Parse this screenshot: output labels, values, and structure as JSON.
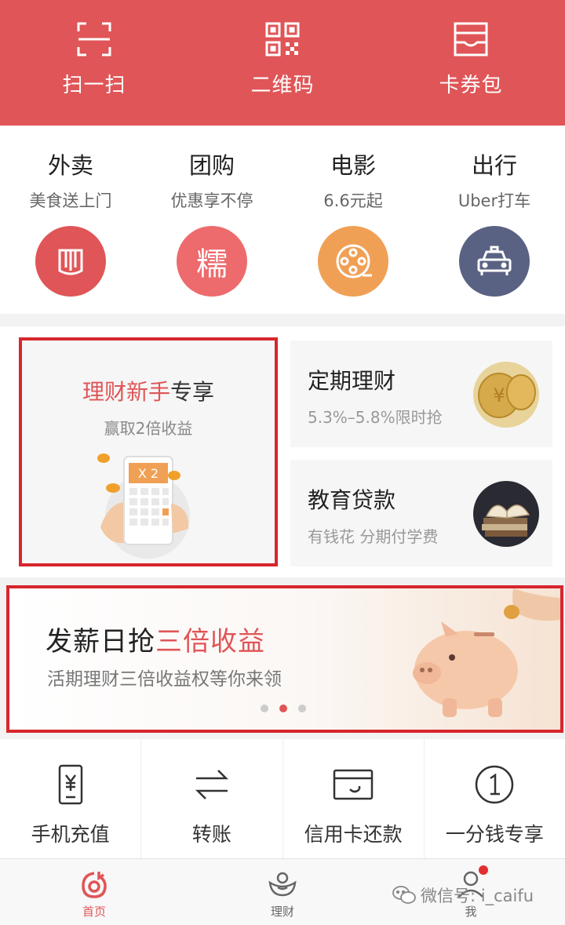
{
  "top_bar": {
    "items": [
      {
        "label": "扫一扫",
        "icon": "scan-icon"
      },
      {
        "label": "二维码",
        "icon": "qr-code-icon"
      },
      {
        "label": "卡券包",
        "icon": "card-wallet-icon"
      }
    ],
    "color": "#e05557"
  },
  "services": [
    {
      "title": "外卖",
      "subtitle": "美食送上门",
      "icon": "fork-icon",
      "color": "#e05557"
    },
    {
      "title": "团购",
      "subtitle": "优惠享不停",
      "icon": "nuo-glyph-icon",
      "glyph": "糯",
      "color": "#ed6b6d"
    },
    {
      "title": "电影",
      "subtitle": "6.6元起",
      "icon": "film-reel-icon",
      "color": "#f0a055"
    },
    {
      "title": "出行",
      "subtitle": "Uber打车",
      "icon": "taxi-icon",
      "color": "#5a6283"
    }
  ],
  "finance": {
    "promo": {
      "title_red": "理财新手",
      "title_rest": "专享",
      "subtitle": "赢取2倍收益",
      "art_text": "X 2"
    },
    "cards": [
      {
        "title": "定期理财",
        "subtitle": "5.3%–5.8%限时抢",
        "icon": "gold-coins-icon"
      },
      {
        "title": "教育贷款",
        "subtitle": "有钱花 分期付学费",
        "icon": "books-icon"
      }
    ]
  },
  "banner": {
    "title_black": "发薪日抢",
    "title_red": "三倍收益",
    "subtitle": "活期理财三倍收益权等你来领",
    "dots": 3,
    "active_dot": 1
  },
  "quick_actions": [
    {
      "label": "手机充值",
      "icon": "phone-yuan-icon"
    },
    {
      "label": "转账",
      "icon": "transfer-arrows-icon"
    },
    {
      "label": "信用卡还款",
      "icon": "credit-card-icon"
    },
    {
      "label": "一分钱专享",
      "icon": "one-cent-icon"
    }
  ],
  "tab_bar": {
    "tabs": [
      {
        "label": "首页",
        "icon": "home-icon",
        "active": true
      },
      {
        "label": "理财",
        "icon": "finance-icon",
        "active": false
      },
      {
        "label": "我",
        "icon": "profile-icon",
        "active": false,
        "badge": true
      }
    ]
  },
  "watermark": {
    "text": "微信号: i_caifu"
  },
  "colors": {
    "accent": "#e05557",
    "highlight_border": "#d7262d"
  }
}
